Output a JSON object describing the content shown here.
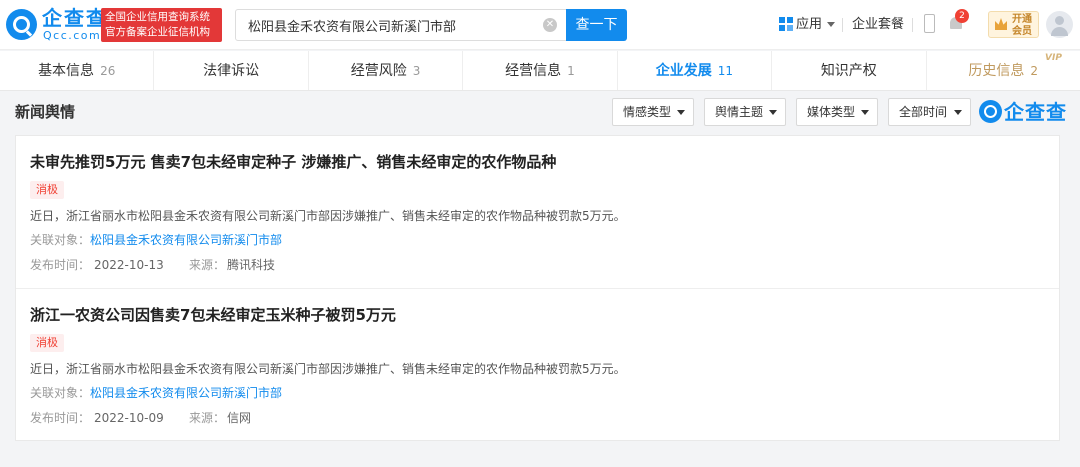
{
  "header": {
    "logo_text": "企查查",
    "logo_domain": "Qcc.com",
    "badge_line1": "全国企业信用查询系统",
    "badge_line2": "官方备案企业征信机构",
    "search_value": "松阳县金禾农资有限公司新溪门市部",
    "search_button": "查一下",
    "apps_label": "应用",
    "suite_label": "企业套餐",
    "notification_count": "2",
    "vip_line1": "开通",
    "vip_line2": "会员"
  },
  "tabs": [
    {
      "label": "基本信息",
      "count": "26"
    },
    {
      "label": "法律诉讼",
      "count": ""
    },
    {
      "label": "经营风险",
      "count": "3"
    },
    {
      "label": "经营信息",
      "count": "1"
    },
    {
      "label": "企业发展",
      "count": "11"
    },
    {
      "label": "知识产权",
      "count": ""
    },
    {
      "label": "历史信息",
      "count": "2",
      "vip": "VIP"
    }
  ],
  "section": {
    "title": "新闻舆情",
    "filters": [
      "情感类型",
      "舆情主题",
      "媒体类型",
      "全部时间"
    ],
    "logo_text": "企查查"
  },
  "news": [
    {
      "title": "未审先推罚5万元 售卖7包未经审定种子 涉嫌推广、销售未经审定的农作物品种",
      "tag": "消极",
      "summary": "近日，浙江省丽水市松阳县金禾农资有限公司新溪门市部因涉嫌推广、销售未经审定的农作物品种被罚款5万元。",
      "related_label": "关联对象：",
      "related_company": "松阳县金禾农资有限公司新溪门市部",
      "date_label": "发布时间：",
      "date": "2022-10-13",
      "source_label": "来源：",
      "source": "腾讯科技"
    },
    {
      "title": "浙江一农资公司因售卖7包未经审定玉米种子被罚5万元",
      "tag": "消极",
      "summary": "近日，浙江省丽水市松阳县金禾农资有限公司新溪门市部因涉嫌推广、销售未经审定的农作物品种被罚款5万元。",
      "related_label": "关联对象：",
      "related_company": "松阳县金禾农资有限公司新溪门市部",
      "date_label": "发布时间：",
      "date": "2022-10-09",
      "source_label": "来源：",
      "source": "信网"
    }
  ],
  "colors": {
    "brand": "#128bed",
    "negative": "#f04134",
    "badge_red": "#e33838",
    "vip_gold": "#c09a5f"
  }
}
